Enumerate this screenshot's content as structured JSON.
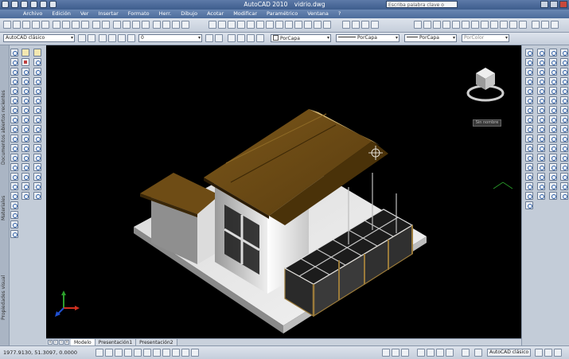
{
  "title_bar": {
    "app": "AutoCAD 2010",
    "document": "vidrio.dwg",
    "search_placeholder": "Escriba palabra clave o frase"
  },
  "menu": [
    "Archivo",
    "Edición",
    "Ver",
    "Insertar",
    "Formato",
    "Herr.",
    "Dibujo",
    "Acotar",
    "Modificar",
    "Paramétrico",
    "Ventana",
    "?"
  ],
  "toolbar": {
    "workspace": "AutoCAD clásico",
    "layer": "0",
    "color": "PorCapa",
    "linetype": "PorCapa",
    "lineweight": "PorCapa",
    "plotstyle": "PorColor"
  },
  "left_palette": {
    "labels": [
      "Documentos abiertos recientes",
      "Materiales",
      "Propiedades visual"
    ]
  },
  "viewport": {
    "viewcube_label": "Sin nombre"
  },
  "layout_tabs": [
    {
      "label": "Modelo",
      "active": true
    },
    {
      "label": "Presentación1",
      "active": false
    },
    {
      "label": "Presentación2",
      "active": false
    }
  ],
  "status": {
    "coordinates": "1977.9130, 51.3097, 0.0000",
    "workspace": "AutoCAD clásico"
  },
  "colors": {
    "roof": "#6a4a14",
    "background": "#000000",
    "chrome": "#c3ccd8"
  }
}
